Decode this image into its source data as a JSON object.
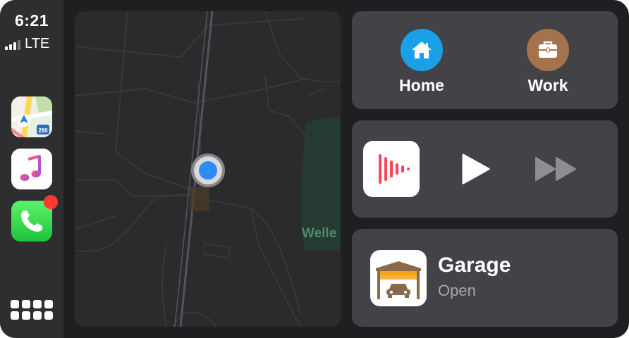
{
  "status": {
    "time": "6:21",
    "network": "LTE",
    "signal_bars": 3
  },
  "sidebar": {
    "apps": [
      {
        "name": "Maps",
        "icon": "maps-icon"
      },
      {
        "name": "Music",
        "icon": "music-icon"
      },
      {
        "name": "Phone",
        "icon": "phone-icon",
        "badge": true
      }
    ],
    "app_grid_icon": "app-grid-icon"
  },
  "map": {
    "label": "Welle"
  },
  "destinations": [
    {
      "label": "Home",
      "icon": "house-icon",
      "color": "#1aa0e6"
    },
    {
      "label": "Work",
      "icon": "briefcase-icon",
      "color": "#a5724e"
    }
  ],
  "now_playing": {
    "app_icon": "podcast-app-icon",
    "controls": [
      "play-icon",
      "fast-forward-icon"
    ]
  },
  "home_accessory": {
    "title": "Garage",
    "status": "Open",
    "icon": "garage-icon"
  },
  "colors": {
    "accent_blue": "#2f8cf6",
    "badge_red": "#ff3b30",
    "card_bg": "#434347"
  }
}
